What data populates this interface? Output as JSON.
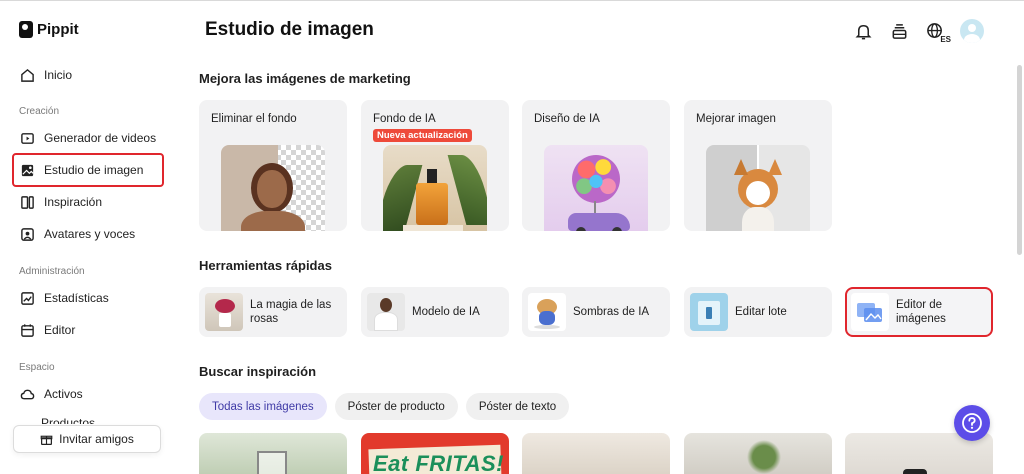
{
  "app": {
    "name": "Pippit"
  },
  "sidebar": {
    "home": "Inicio",
    "sections": {
      "creation": "Creación",
      "admin": "Administración",
      "space": "Espacio"
    },
    "items": [
      {
        "label": "Generador de videos",
        "icon": "video-icon"
      },
      {
        "label": "Estudio de imagen",
        "icon": "image-studio-icon"
      },
      {
        "label": "Inspiración",
        "icon": "inspiration-icon"
      },
      {
        "label": "Avatares y voces",
        "icon": "avatar-voice-icon"
      },
      {
        "label": "Estadísticas",
        "icon": "chart-icon"
      },
      {
        "label": "Editor",
        "icon": "calendar-icon"
      },
      {
        "label": "Activos",
        "icon": "cloud-icon"
      },
      {
        "label": "Productos",
        "icon": "product-icon"
      }
    ],
    "invite": "Invitar amigos"
  },
  "header": {
    "title": "Estudio de imagen",
    "language_badge": "ES"
  },
  "marketing": {
    "heading": "Mejora las imágenes de marketing",
    "cards": [
      {
        "title": "Eliminar el fondo"
      },
      {
        "title": "Fondo de IA",
        "badge": "Nueva actualización"
      },
      {
        "title": "Diseño de IA"
      },
      {
        "title": "Mejorar imagen"
      }
    ]
  },
  "quick_tools": {
    "heading": "Herramientas rápidas",
    "items": [
      {
        "label": "La magia de las rosas"
      },
      {
        "label": "Modelo de IA"
      },
      {
        "label": "Sombras de IA"
      },
      {
        "label": "Editar lote"
      },
      {
        "label": "Editor de imágenes"
      }
    ]
  },
  "inspiration": {
    "heading": "Buscar inspiración",
    "tabs": [
      "Todas las imágenes",
      "Póster de producto",
      "Póster de texto"
    ],
    "poster_text": "Eat FRITAS!"
  },
  "colors": {
    "highlight_red": "#e0262d",
    "accent_purple": "#5c4de8",
    "badge_red": "#ee4a3a"
  }
}
